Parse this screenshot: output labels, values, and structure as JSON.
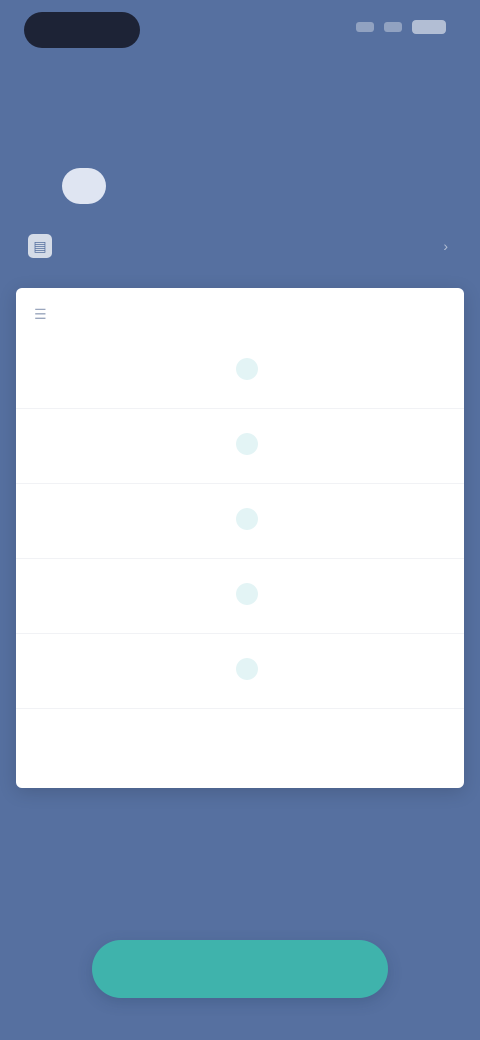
{
  "status_bar": {
    "time": "",
    "icons": [
      "signal-icon",
      "wifi-icon",
      "battery-icon"
    ]
  },
  "header": {
    "subtitle": "",
    "title": ""
  },
  "tabs": [
    {
      "label": "",
      "active": false
    },
    {
      "label": "",
      "active": true
    },
    {
      "label": "",
      "active": false
    },
    {
      "label": "",
      "active": false
    }
  ],
  "info_row": {
    "icon": "document-icon",
    "text": ""
  },
  "card": {
    "header_icon": "filter-icon",
    "header_title": "",
    "rows": [
      {
        "name": "",
        "badge": "",
        "value": ""
      },
      {
        "name": "",
        "badge": "",
        "value": ""
      },
      {
        "name": "",
        "badge": "",
        "value": ""
      },
      {
        "name": "",
        "badge": "",
        "value": ""
      },
      {
        "name": "",
        "badge": "",
        "value": ""
      }
    ],
    "footer": ""
  },
  "primary_button": {
    "label": ""
  },
  "colors": {
    "background": "#5670a0",
    "card": "#ffffff",
    "accent_button": "#3fb3ac",
    "value_text": "#e26b6b",
    "badge": "#3eb3b3"
  }
}
